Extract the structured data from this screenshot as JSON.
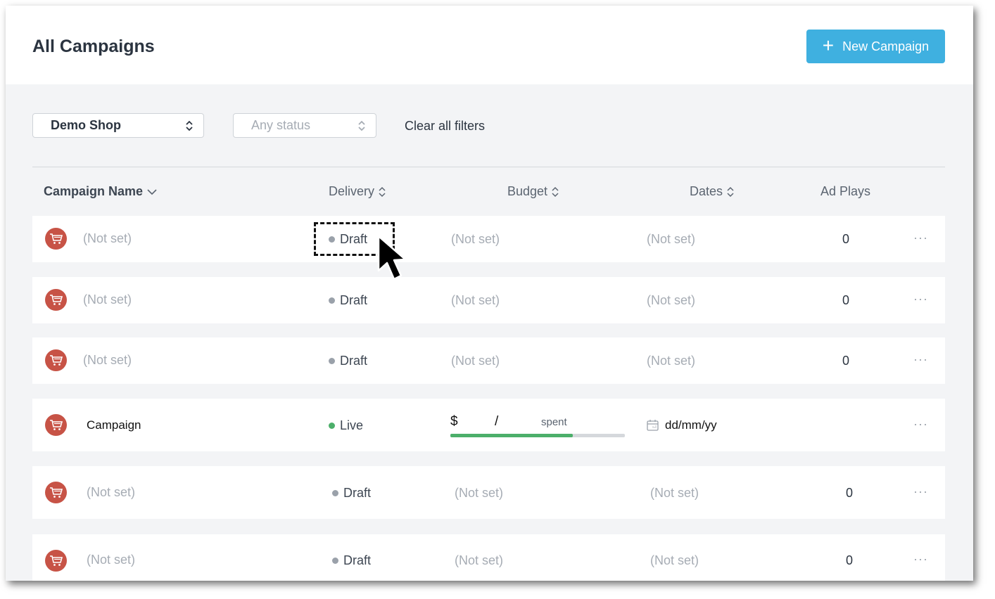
{
  "header": {
    "title": "All Campaigns",
    "new_button_label": "New Campaign"
  },
  "filters": {
    "shop_value": "Demo Shop",
    "status_placeholder": "Any status",
    "clear_label": "Clear all filters"
  },
  "table": {
    "columns": [
      "Campaign Name",
      "Delivery",
      "Budget",
      "Dates",
      "Ad Plays"
    ],
    "rows": [
      {
        "name": "(Not set)",
        "delivery": "Draft",
        "budget": "(Not set)",
        "dates": "(Not set)",
        "ad_plays": "0"
      },
      {
        "name": "(Not set)",
        "delivery": "Draft",
        "budget": "(Not set)",
        "dates": "(Not set)",
        "ad_plays": "0"
      },
      {
        "name": "(Not set)",
        "delivery": "Draft",
        "budget": "(Not set)",
        "dates": "(Not set)",
        "ad_plays": "0"
      },
      {
        "name": "Campaign",
        "delivery": "Live",
        "budget_currency": "$",
        "budget_separator": "/",
        "budget_suffix": "spent",
        "budget_spent_fraction": 0.7,
        "dates": "dd/mm/yy"
      },
      {
        "name": "(Not set)",
        "delivery": "Draft",
        "budget": "(Not set)",
        "dates": "(Not set)",
        "ad_plays": "0"
      },
      {
        "name": "(Not set)",
        "delivery": "Draft",
        "budget": "(Not set)",
        "dates": "(Not set)",
        "ad_plays": "0"
      }
    ],
    "more_glyph": "···"
  },
  "colors": {
    "accent": "#3fb0e0",
    "cart_icon": "#c75346",
    "live": "#4caf6a",
    "draft": "#9aa1aa"
  },
  "icons": {
    "plus": "plus-icon",
    "cart": "shopping-cart-icon",
    "calendar": "calendar-icon",
    "sort": "sort-icon",
    "more": "more-options-icon",
    "cursor": "mouse-pointer-icon"
  }
}
